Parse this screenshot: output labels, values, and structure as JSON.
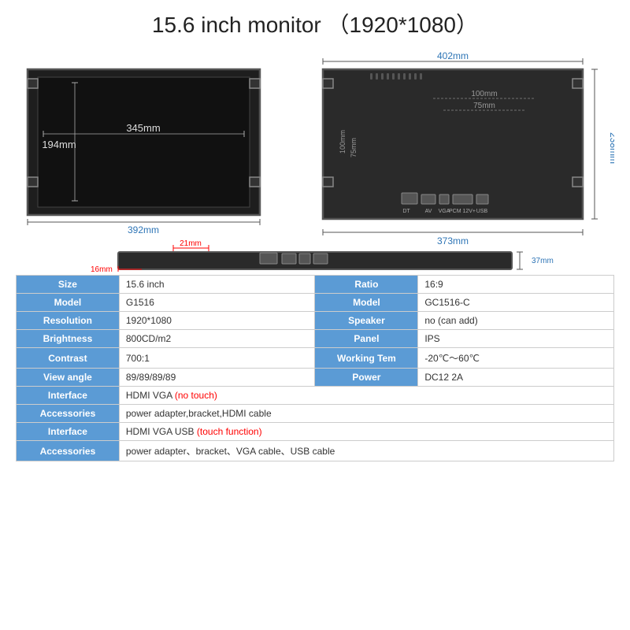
{
  "title": "15.6 inch monitor （1920*1080）",
  "diagrams": {
    "front": {
      "width_label": "345mm",
      "height_label": "194mm",
      "total_width": "392mm"
    },
    "back": {
      "total_width": "402mm",
      "total_height": "238mm",
      "vesa_h1": "100mm",
      "vesa_h2": "75mm",
      "vesa_v1": "100mm",
      "vesa_v2": "75mm",
      "bottom_width": "373mm"
    },
    "bottom": {
      "dim1": "21mm",
      "dim2": "16mm",
      "dim3": "37mm"
    }
  },
  "specs": [
    {
      "label": "Size",
      "value": "15.6 inch",
      "label2": "Ratio",
      "value2": "16:9"
    },
    {
      "label": "Model",
      "value": "G1516",
      "label2": "Model",
      "value2": "GC1516-C"
    },
    {
      "label": "Resolution",
      "value": "1920*1080",
      "label2": "Speaker",
      "value2": "no (can add)"
    },
    {
      "label": "Brightness",
      "value": "800CD/m2",
      "label2": "Panel",
      "value2": "IPS"
    },
    {
      "label": "Contrast",
      "value": "700:1",
      "label2": "Working Tem",
      "value2": "-20℃～60℃"
    },
    {
      "label": "View angle",
      "value": "89/89/89/89",
      "label2": "Power",
      "value2": "DC12  2A"
    },
    {
      "label": "Interface",
      "value_plain": "HDMI  VGA ",
      "value_red": "(no touch)",
      "colspan": true
    },
    {
      "label": "Accessories",
      "value_plain": "power adapter,bracket,HDMI cable",
      "colspan": true
    },
    {
      "label": "Interface",
      "value_plain": "HDMI  VGA  USB ",
      "value_red": "(touch function)",
      "colspan": true
    },
    {
      "label": "Accessories",
      "value_plain": "power adapter、bracket、VGA cable、USB cable",
      "colspan": true
    }
  ]
}
